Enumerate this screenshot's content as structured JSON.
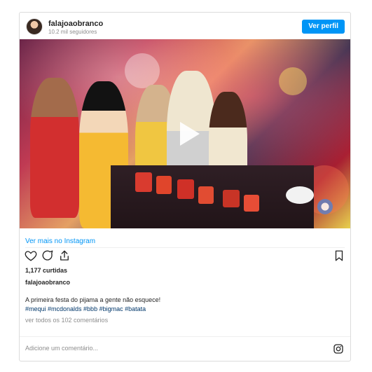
{
  "header": {
    "username": "falajoaobranco",
    "followers": "10.2 mil seguidores",
    "view_profile": "Ver perfil"
  },
  "media": {
    "play_icon": "play-icon"
  },
  "more_link": "Ver mais no Instagram",
  "stats": {
    "likes": "1,177 curtidas"
  },
  "post": {
    "author": "falajoaobranco",
    "caption": "A primeira festa do pijama a gente não esquece!",
    "hashtags": "#mequi #mcdonalds #bbb #bigmac #batata",
    "comments": "ver todos os 102 comentários"
  },
  "comment_bar": {
    "placeholder": "Adicione um comentário..."
  },
  "icons": [
    "heart-icon",
    "comment-icon",
    "share-icon",
    "bookmark-icon",
    "instagram-icon"
  ],
  "colors": {
    "accent": "#0095f6",
    "muted": "#8e8e8e"
  }
}
